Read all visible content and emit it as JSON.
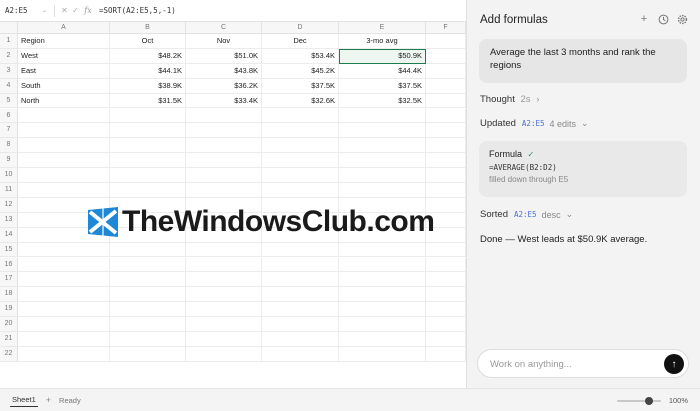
{
  "formula_bar": {
    "name_box": "A2:E5",
    "formula": "=SORT(A2:E5,5,-1)",
    "fx": "fx"
  },
  "sheet": {
    "columns": [
      "A",
      "B",
      "C",
      "D",
      "E",
      "F"
    ],
    "rows": [
      "1",
      "2",
      "3",
      "4",
      "5",
      "6",
      "7",
      "8",
      "9",
      "10",
      "11",
      "12",
      "13",
      "14",
      "15",
      "16",
      "17",
      "18",
      "19",
      "20",
      "21",
      "22"
    ],
    "header_row": [
      "Region",
      "Oct",
      "Nov",
      "Dec",
      "3-mo avg"
    ],
    "data": [
      [
        "West",
        "$48.2K",
        "$51.0K",
        "$53.4K",
        "$50.9K"
      ],
      [
        "East",
        "$44.1K",
        "$43.8K",
        "$45.2K",
        "$44.4K"
      ],
      [
        "South",
        "$38.9K",
        "$36.2K",
        "$37.5K",
        "$37.5K"
      ],
      [
        "North",
        "$31.5K",
        "$33.4K",
        "$32.6K",
        "$32.5K"
      ]
    ]
  },
  "watermark": {
    "text": "TheWindowsClub.com"
  },
  "status": {
    "sheet_tab": "Sheet1",
    "add": "+",
    "ready": "Ready",
    "zoom": "100%",
    "zoom_level": 0.5
  },
  "panel": {
    "title": "Add formulas",
    "user_message": "Average the last 3 months and rank the regions",
    "thought_label": "Thought",
    "thought_time": "2s",
    "updated_label": "Updated",
    "updated_range": "A2:E5",
    "updated_edits": "4 edits",
    "formula_card": {
      "title": "Formula",
      "formula": "=AVERAGE(B2:D2)",
      "subtitle": "filled down through E5"
    },
    "sorted_label": "Sorted",
    "sorted_range": "A2:E5",
    "sorted_order": "desc",
    "done_text": "Done — West leads at $50.9K average.",
    "input_placeholder": "Work on anything..."
  }
}
